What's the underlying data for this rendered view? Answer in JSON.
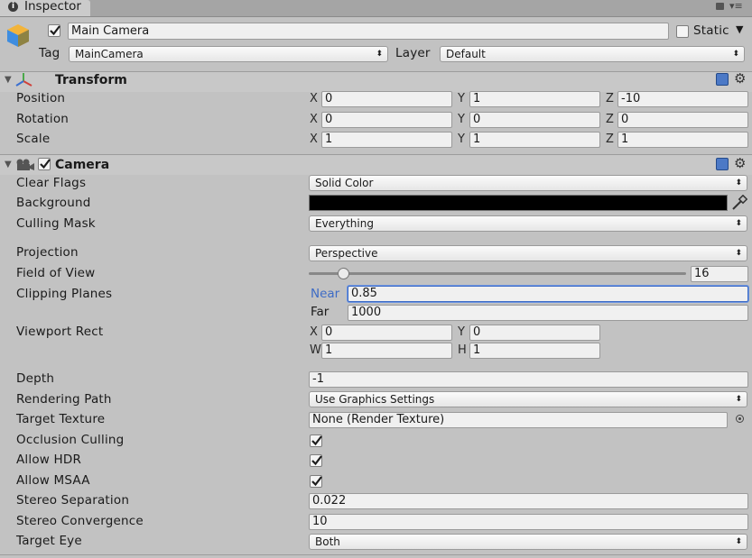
{
  "tab": {
    "title": "Inspector"
  },
  "object": {
    "name": "Main Camera",
    "static_label": "Static",
    "tag_label": "Tag",
    "tag_value": "MainCamera",
    "layer_label": "Layer",
    "layer_value": "Default"
  },
  "transform": {
    "title": "Transform",
    "rows": [
      {
        "label": "Position",
        "x": "0",
        "y": "1",
        "z": "-10"
      },
      {
        "label": "Rotation",
        "x": "0",
        "y": "0",
        "z": "0"
      },
      {
        "label": "Scale",
        "x": "1",
        "y": "1",
        "z": "1"
      }
    ]
  },
  "axes": {
    "x": "X",
    "y": "Y",
    "z": "Z",
    "w": "W",
    "h": "H"
  },
  "camera": {
    "title": "Camera",
    "clear_flags_label": "Clear Flags",
    "clear_flags_value": "Solid Color",
    "background_label": "Background",
    "background_color": "#000000",
    "culling_mask_label": "Culling Mask",
    "culling_mask_value": "Everything",
    "projection_label": "Projection",
    "projection_value": "Perspective",
    "fov_label": "Field of View",
    "fov_value": "16",
    "clipping_label": "Clipping Planes",
    "near_label": "Near",
    "near_value": "0.85",
    "far_label": "Far",
    "far_value": "1000",
    "viewport_label": "Viewport Rect",
    "viewport_x": "0",
    "viewport_y": "0",
    "viewport_w": "1",
    "viewport_h": "1",
    "depth_label": "Depth",
    "depth_value": "-1",
    "rendering_path_label": "Rendering Path",
    "rendering_path_value": "Use Graphics Settings",
    "target_texture_label": "Target Texture",
    "target_texture_value": "None (Render Texture)",
    "occlusion_label": "Occlusion Culling",
    "hdr_label": "Allow HDR",
    "msaa_label": "Allow MSAA",
    "stereo_sep_label": "Stereo Separation",
    "stereo_sep_value": "0.022",
    "stereo_conv_label": "Stereo Convergence",
    "stereo_conv_value": "10",
    "target_eye_label": "Target Eye",
    "target_eye_value": "Both"
  },
  "icons": {
    "tab": "info-icon",
    "lock": "lock-icon",
    "menu": "menu-icon",
    "cube": "game-object-cube-icon",
    "transform": "transform-axes-icon",
    "camera": "camera-icon",
    "help": "help-book-icon",
    "gear": "gear-icon",
    "picker": "eyedropper-icon",
    "target": "object-picker-icon"
  },
  "colors": {
    "accent": "#3d6bc5",
    "panel": "#c2c2c2"
  }
}
